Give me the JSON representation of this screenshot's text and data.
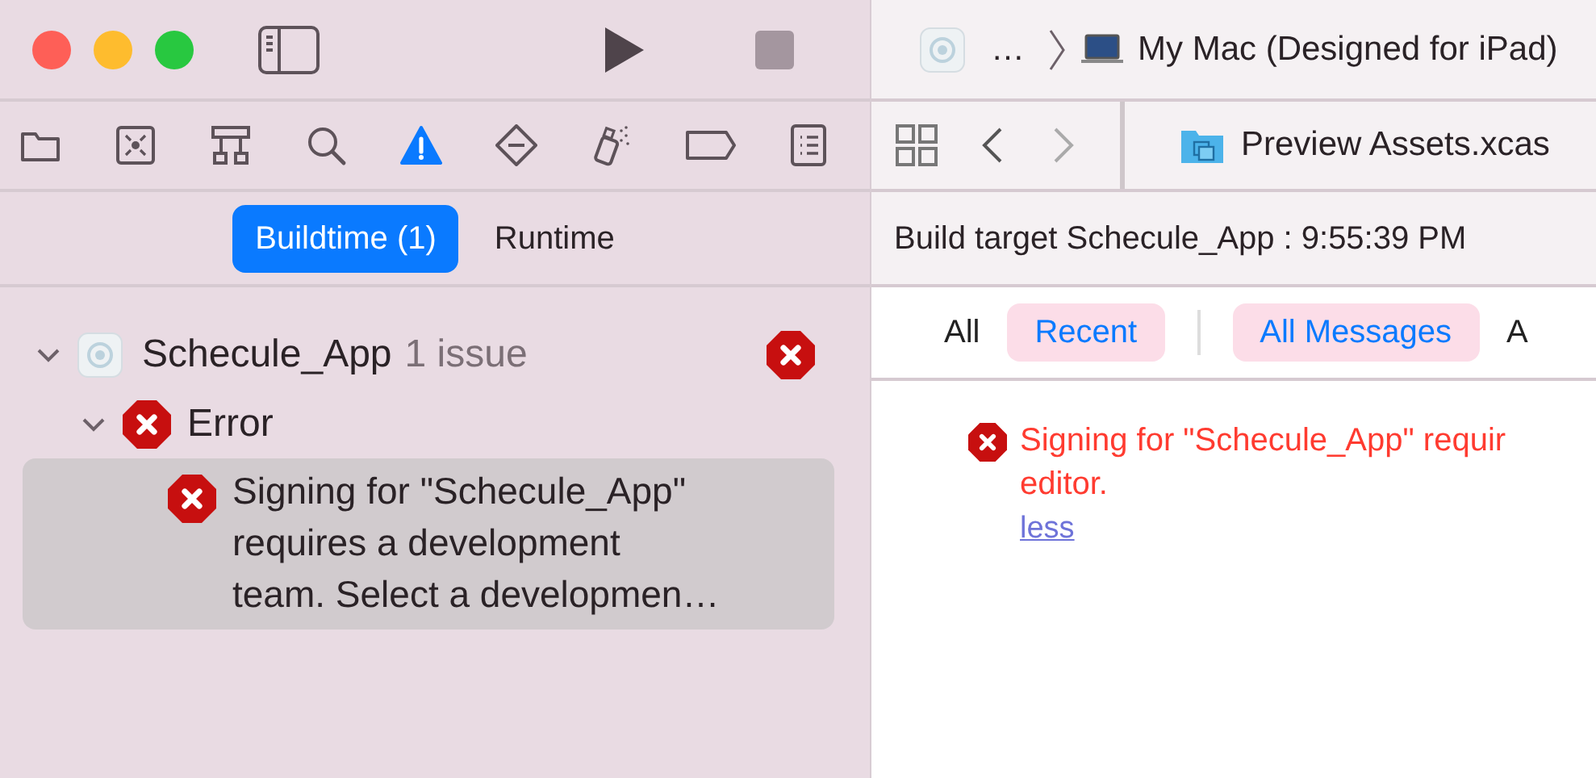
{
  "navigator_tabs": [
    {
      "kind": "folder",
      "selected": false
    },
    {
      "kind": "source-control",
      "selected": false
    },
    {
      "kind": "hierarchy",
      "selected": false
    },
    {
      "kind": "search",
      "selected": false
    },
    {
      "kind": "warning",
      "selected": true
    },
    {
      "kind": "test",
      "selected": false
    },
    {
      "kind": "debug",
      "selected": false
    },
    {
      "kind": "breakpoint",
      "selected": false
    },
    {
      "kind": "report",
      "selected": false
    }
  ],
  "scope_segments": [
    {
      "label": "Buildtime (1)",
      "selected": true
    },
    {
      "label": "Runtime",
      "selected": false
    }
  ],
  "issues": [
    {
      "label": "Schecule_App",
      "count": "1 issue",
      "expanded": true,
      "children": [
        {
          "label": "Error",
          "expanded": true,
          "children": [
            {
              "lines": [
                "Signing for \"Schecule_App\"",
                "requires a development",
                "team. Select a developmen…"
              ],
              "selected": true
            }
          ]
        }
      ]
    }
  ],
  "breadcrumb": {
    "ellipsis": "…",
    "device": "My Mac (Designed for iPad)"
  },
  "editor_tab": {
    "label": "Preview Assets.xcas"
  },
  "build_log": {
    "title": "Build target Schecule_App : 9:55:39 PM",
    "filter_groups": [
      [
        {
          "label": "All",
          "selected": false
        },
        {
          "label": "Recent",
          "selected": true
        }
      ],
      [
        {
          "label": "All Messages",
          "selected": true
        },
        {
          "label": "A",
          "selected": false
        }
      ]
    ],
    "message": {
      "lines": [
        "Signing for \"Schecule_App\" requir",
        "editor."
      ],
      "link": "less"
    }
  }
}
